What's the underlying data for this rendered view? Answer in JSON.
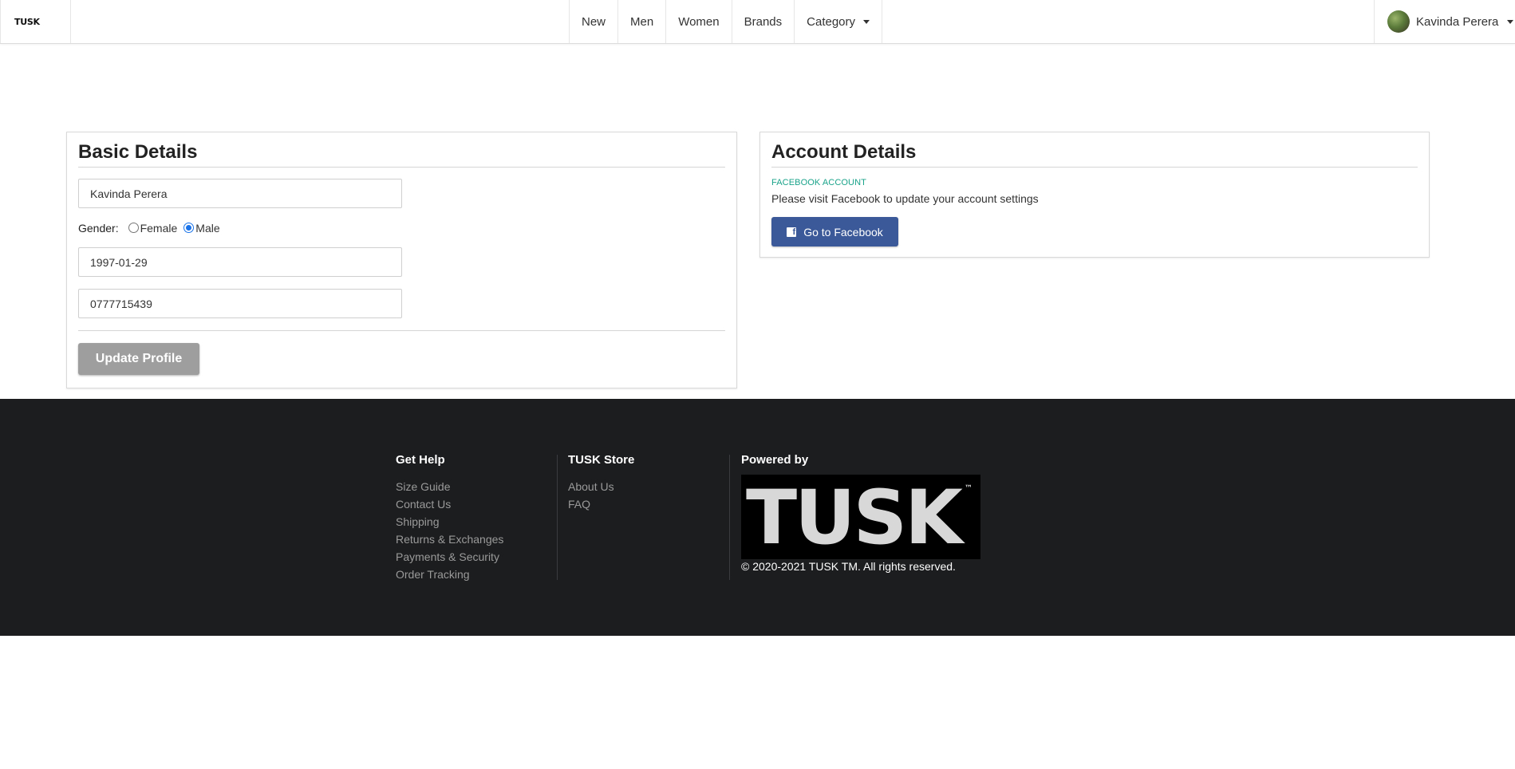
{
  "nav": {
    "brand": "TUSK",
    "items": [
      "New",
      "Men",
      "Women",
      "Brands",
      "Category"
    ],
    "user_name": "Kavinda Perera"
  },
  "basic": {
    "title": "Basic Details",
    "name_value": "Kavinda Perera",
    "gender_label": "Gender:",
    "gender_options": [
      "Female",
      "Male"
    ],
    "gender_selected": "Male",
    "dob_value": "1997-01-29",
    "phone_value": "0777715439",
    "update_label": "Update Profile"
  },
  "account": {
    "title": "Account Details",
    "fb_label": "FACEBOOK ACCOUNT",
    "fb_text": "Please visit Facebook to update your account settings",
    "fb_button": "Go to Facebook"
  },
  "footer": {
    "help_title": "Get Help",
    "help_links": [
      "Size Guide",
      "Contact Us",
      "Shipping",
      "Returns & Exchanges",
      "Payments & Security",
      "Order Tracking"
    ],
    "store_title": "TUSK Store",
    "store_links": [
      "About Us",
      "FAQ"
    ],
    "powered_title": "Powered by",
    "logo_text": "TUSK",
    "logo_tm": "™",
    "copyright": "© 2020-2021 TUSK TM. All rights reserved."
  },
  "colors": {
    "facebook": "#3b5998",
    "footer_bg": "#1c1d1f",
    "fb_label": "#1aa38a",
    "update_button": "#9e9e9e"
  }
}
